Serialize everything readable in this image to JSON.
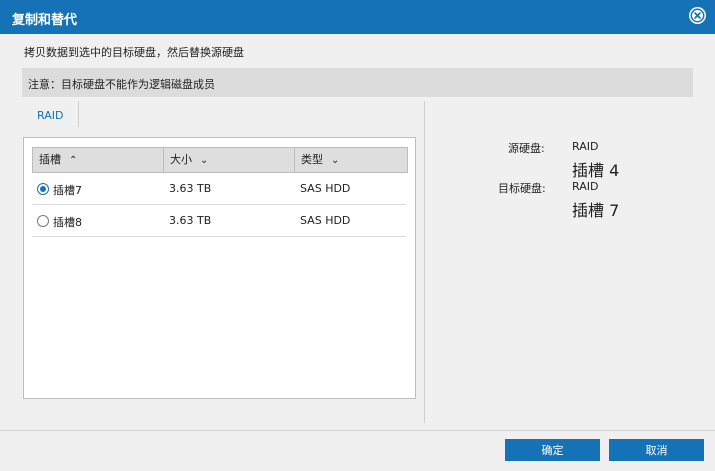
{
  "dialog": {
    "title": "复制和替代",
    "description": "拷贝数据到选中的目标硬盘，然后替换源硬盘",
    "notice": "注意：目标硬盘不能作为逻辑磁盘成员"
  },
  "tab": {
    "label": "RAID"
  },
  "table": {
    "columns": [
      {
        "label": "插槽",
        "arrow": "^"
      },
      {
        "label": "大小",
        "arrow": "v"
      },
      {
        "label": "类型",
        "arrow": "v"
      }
    ],
    "rows": [
      {
        "slot": "插槽7",
        "size": "3.63 TB",
        "type": "SAS HDD",
        "selected": true
      },
      {
        "slot": "插槽8",
        "size": "3.63 TB",
        "type": "SAS HDD",
        "selected": false
      }
    ]
  },
  "summary": {
    "source_label": "源硬盘:",
    "source_value": "RAID",
    "source_slot": "插槽 4",
    "target_label": "目标硬盘:",
    "target_value": "RAID",
    "target_slot": "插槽 7"
  },
  "buttons": {
    "ok": "确定",
    "cancel": "取消"
  },
  "colors": {
    "accent": "#1572b6",
    "panel": "#f0f0f0",
    "notice_bg": "#dcdcdc"
  },
  "icons": {
    "close": "close-circle-icon",
    "radio": "radio-icon",
    "sort": "sort-arrow-icon"
  }
}
